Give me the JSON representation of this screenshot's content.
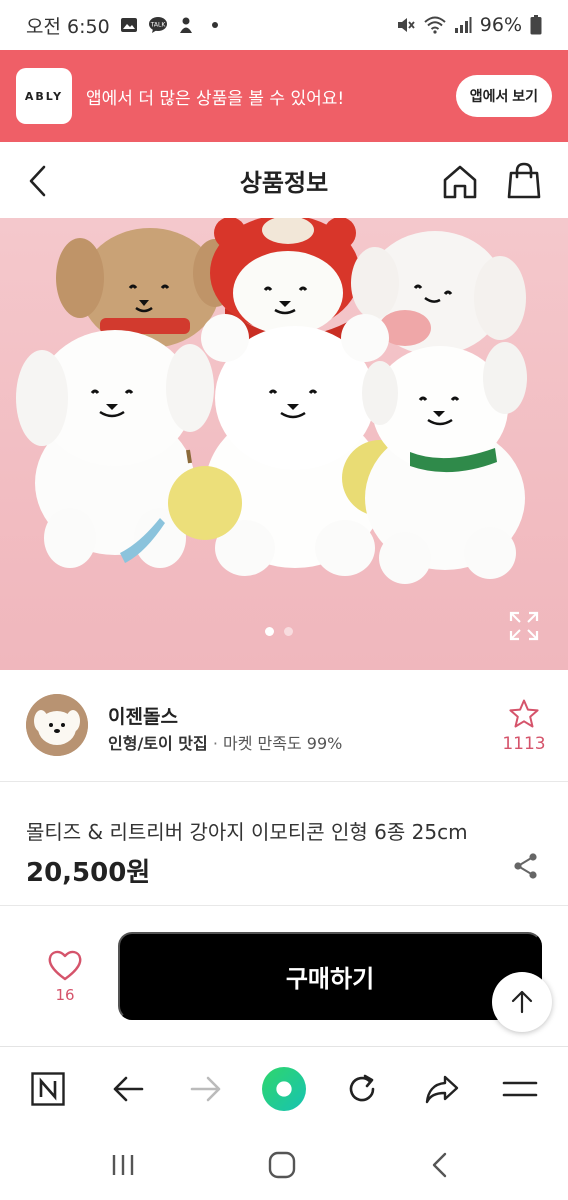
{
  "status_bar": {
    "time": "오전 6:50",
    "battery": "96%"
  },
  "app_banner": {
    "logo": "ABLY",
    "message": "앱에서 더 많은 상품을 볼 수 있어요!",
    "button_label": "앱에서 보기"
  },
  "header": {
    "title": "상품정보"
  },
  "gallery": {
    "page_count": 2,
    "current_page": 1
  },
  "seller": {
    "name": "이젠돌스",
    "category": "인형/토이 맛집",
    "separator": " · ",
    "satisfaction": "마켓 만족도 99%",
    "favorite_count": "1113"
  },
  "product": {
    "name": "몰티즈 & 리트리버 강아지 이모티콘 인형 6종 25cm",
    "price": "20,500원"
  },
  "buy_bar": {
    "like_count": "16",
    "buy_label": "구매하기"
  },
  "colors": {
    "banner": "#ef5f67",
    "accent_pink": "#d5546b",
    "buy_button": "#000000"
  }
}
